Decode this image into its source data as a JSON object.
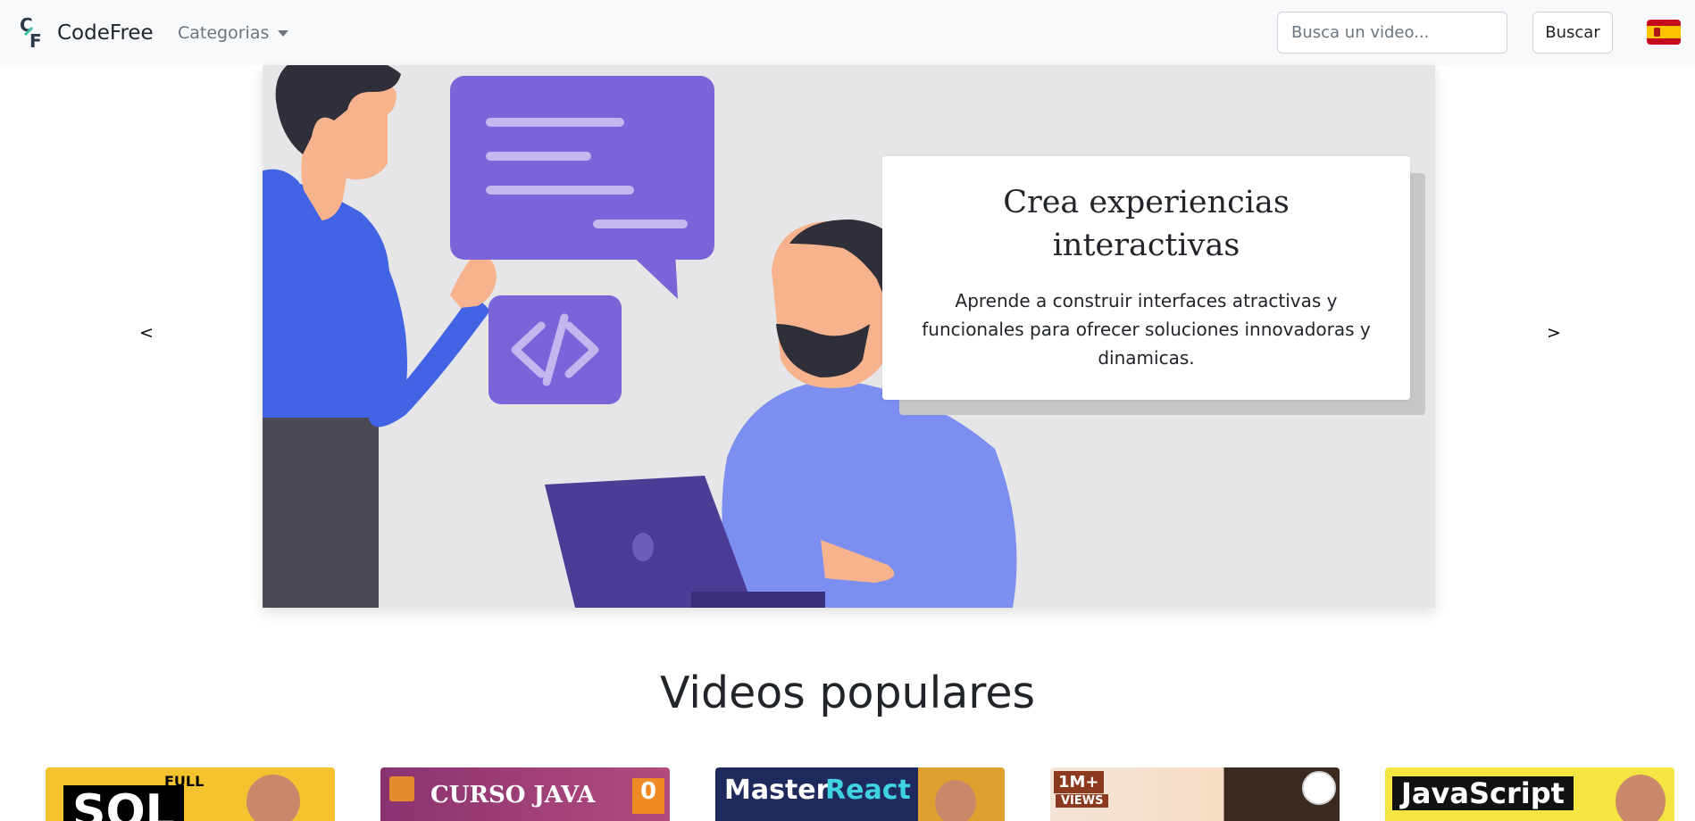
{
  "navbar": {
    "brand": "CodeFree",
    "logo_letters": "CF",
    "categories_label": "Categorias",
    "search_placeholder": "Busca un video...",
    "search_button": "Buscar",
    "language_flag": "spain-flag-icon"
  },
  "carousel": {
    "prev_label": "<",
    "next_label": ">",
    "caption_title": "Crea experiencias interactivas",
    "caption_text": "Aprende a construir interfaces atractivas y funcionales para ofrecer soluciones innovadoras y dinamicas."
  },
  "videos": {
    "section_title": "Videos populares",
    "items": [
      {
        "thumb_text": "SQL",
        "badge": "FULL",
        "color": "#f5c230"
      },
      {
        "thumb_text": "CURSO JAVA",
        "badge": "0",
        "color": "#9c3b6f"
      },
      {
        "thumb_text_a": "Master",
        "thumb_text_b": "React",
        "color": "#1f2a5c"
      },
      {
        "thumb_text": "1M+",
        "badge": "VIEWS",
        "color": "#f4e5d8"
      },
      {
        "thumb_text": "JavaScript",
        "color": "#f4e542"
      }
    ]
  },
  "colors": {
    "navbar_bg": "#f8f9fa",
    "carousel_bg": "#e6e6e8",
    "purple": "#7b63d8",
    "shirt_blue": "#4264e4"
  }
}
